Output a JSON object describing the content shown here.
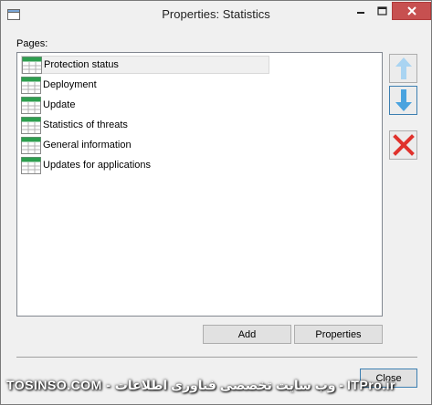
{
  "window": {
    "title": "Properties: Statistics"
  },
  "pages_label": "Pages:",
  "pages": [
    {
      "label": "Protection status",
      "selected": true
    },
    {
      "label": "Deployment",
      "selected": false
    },
    {
      "label": "Update",
      "selected": false
    },
    {
      "label": "Statistics of threats",
      "selected": false
    },
    {
      "label": "General information",
      "selected": false
    },
    {
      "label": "Updates for applications",
      "selected": false
    }
  ],
  "buttons": {
    "add": "Add",
    "properties": "Properties",
    "close": "Close"
  },
  "watermark": "TOSINSO.COM - وب سایت تخصصی فناوری اطلاعات - ITPro.ir",
  "icons": {
    "move_up": "arrow-up-icon",
    "move_down": "arrow-down-icon",
    "remove": "remove-x-icon",
    "page": "table-page-icon"
  },
  "colors": {
    "close_button": "#c75050",
    "arrow_blue": "#4aa3df",
    "remove_red": "#e0322c",
    "icon_green": "#2e9e4f"
  }
}
